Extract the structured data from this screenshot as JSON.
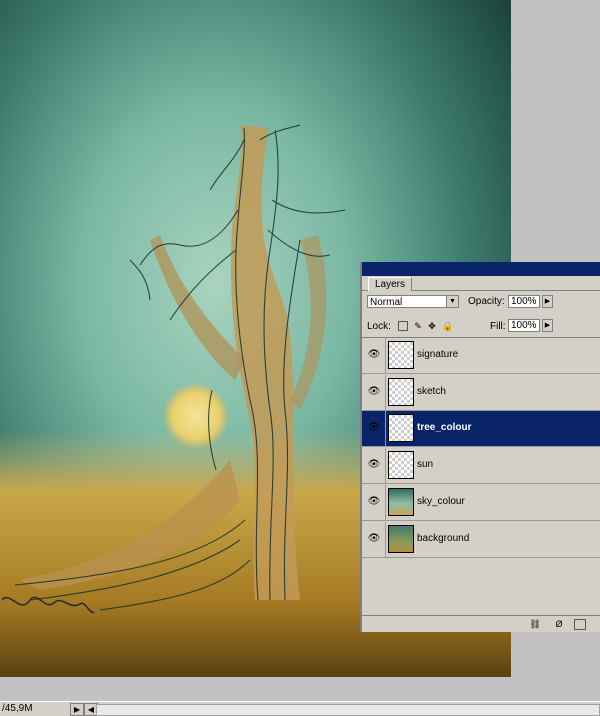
{
  "panel": {
    "tab_label": "Layers",
    "blend_mode": "Normal",
    "opacity_label": "Opacity:",
    "opacity_value": "100%",
    "lock_label": "Lock:",
    "fill_label": "Fill:",
    "fill_value": "100%"
  },
  "layers": [
    {
      "name": "signature",
      "visible": true,
      "selected": false,
      "thumb": "transparent"
    },
    {
      "name": "sketch",
      "visible": true,
      "selected": false,
      "thumb": "transparent"
    },
    {
      "name": "tree_colour",
      "visible": true,
      "selected": true,
      "thumb": "transparent"
    },
    {
      "name": "sun",
      "visible": true,
      "selected": false,
      "thumb": "transparent"
    },
    {
      "name": "sky_colour",
      "visible": true,
      "selected": false,
      "thumb": "image"
    },
    {
      "name": "background",
      "visible": true,
      "selected": false,
      "thumb": "image"
    }
  ],
  "statusbar": {
    "doc_size": "/45,9M"
  },
  "icons": {
    "visibility": "eye-icon",
    "lock_transparency": "lock-transparency-icon",
    "lock_paint": "brush-icon",
    "lock_position": "move-icon",
    "lock_all": "lock-icon",
    "link": "link-icon",
    "styles": "fx-icon",
    "mask": "mask-icon"
  },
  "colors": {
    "selection": "#0a246a",
    "panel_bg": "#d4d0c8",
    "sky_top": "#1f4f47",
    "sky_mid": "#6fae9c",
    "ground": "#b8902e"
  }
}
